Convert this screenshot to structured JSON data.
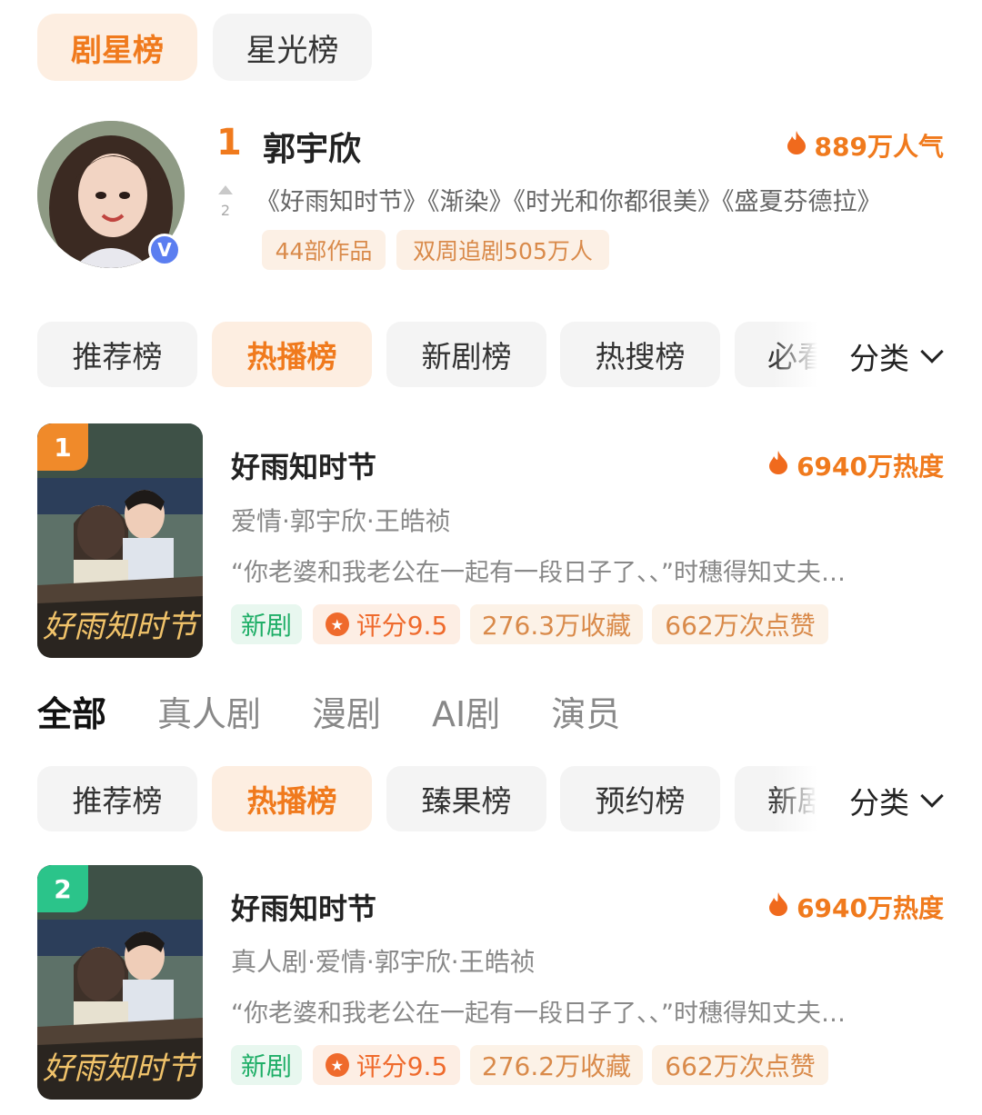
{
  "top_tabs": [
    {
      "label": "剧星榜",
      "active": true
    },
    {
      "label": "星光榜",
      "active": false
    }
  ],
  "star": {
    "rank": "1",
    "name": "郭宇欣",
    "popularity": "889万人气",
    "prev_rank": "2",
    "works": "《好雨知时节》《渐染》《时光和你都很美》《盛夏芬德拉》",
    "pill_works": "44部作品",
    "pill_follow": "双周追剧505万人",
    "badge": "V"
  },
  "chips_1": [
    "推荐榜",
    "热播榜",
    "新剧榜",
    "热搜榜",
    "必看"
  ],
  "chips_2": [
    "推荐榜",
    "热播榜",
    "臻果榜",
    "预约榜",
    "新剧"
  ],
  "classify_label": "分类",
  "mid_nav": [
    "全部",
    "真人剧",
    "漫剧",
    "AI剧",
    "演员"
  ],
  "dramas": [
    {
      "rank": "1",
      "rank_color": "#f08a2a",
      "title": "好雨知时节",
      "heat": "6940万热度",
      "tags": "爱情·郭宇欣·王皓祯",
      "desc": "“你老婆和我老公在一起有一段日子了、、”时穗得知丈夫…",
      "badge_new": "新剧",
      "score": "评分9.5",
      "favorites": "276.3万收藏",
      "likes": "662万次点赞",
      "poster_title": "好雨知时节"
    },
    {
      "rank": "2",
      "rank_color": "#2bc48a",
      "title": "好雨知时节",
      "heat": "6940万热度",
      "tags": "真人剧·爱情·郭宇欣·王皓祯",
      "desc": "“你老婆和我老公在一起有一段日子了、、”时穗得知丈夫…",
      "badge_new": "新剧",
      "score": "评分9.5",
      "favorites": "276.2万收藏",
      "likes": "662万次点赞",
      "poster_title": "好雨知时节"
    }
  ],
  "colors": {
    "accent": "#f07a1d",
    "green": "#1fae67",
    "chip_bg": "#f4f4f4"
  },
  "icons": [
    "flame-icon",
    "star-icon",
    "chevron-down-icon",
    "verified-icon"
  ]
}
